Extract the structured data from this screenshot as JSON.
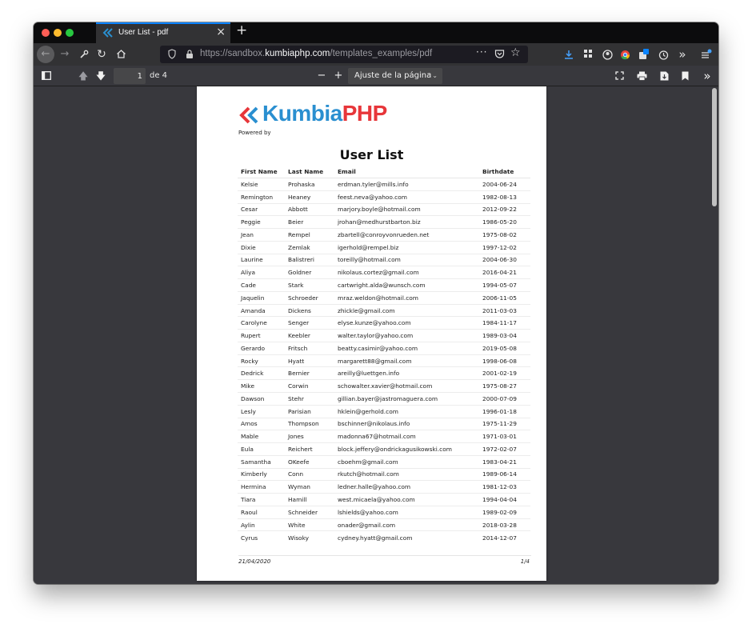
{
  "tab": {
    "title": "User List - pdf",
    "close": "×",
    "new_tab": "+"
  },
  "url": {
    "prefix": "https://sandbox.",
    "host": "kumbiaphp.com",
    "path": "/templates_examples/pdf",
    "more": "···"
  },
  "pdf_toolbar": {
    "page_number": "1",
    "page_of": "de 4",
    "zoom_out": "−",
    "zoom_in": "+",
    "zoom_label": "Ajuste de la página",
    "zoom_caret": "⌃⌄"
  },
  "document": {
    "logo_kumbia": "Kumbia",
    "logo_php": "PHP",
    "powered_by": "Powered by",
    "title": "User List",
    "columns": [
      "First Name",
      "Last Name",
      "Email",
      "Birthdate"
    ],
    "rows": [
      [
        "Kelsie",
        "Prohaska",
        "erdman.tyler@mills.info",
        "2004-06-24"
      ],
      [
        "Remington",
        "Heaney",
        "feest.neva@yahoo.com",
        "1982-08-13"
      ],
      [
        "Cesar",
        "Abbott",
        "marjory.boyle@hotmail.com",
        "2012-09-22"
      ],
      [
        "Peggie",
        "Beier",
        "jrohan@medhurstbarton.biz",
        "1986-05-20"
      ],
      [
        "Jean",
        "Rempel",
        "zbartell@conroyvonrueden.net",
        "1975-08-02"
      ],
      [
        "Dixie",
        "Zemlak",
        "igerhold@rempel.biz",
        "1997-12-02"
      ],
      [
        "Laurine",
        "Balistreri",
        "toreilly@hotmail.com",
        "2004-06-30"
      ],
      [
        "Aliya",
        "Goldner",
        "nikolaus.cortez@gmail.com",
        "2016-04-21"
      ],
      [
        "Cade",
        "Stark",
        "cartwright.alda@wunsch.com",
        "1994-05-07"
      ],
      [
        "Jaquelin",
        "Schroeder",
        "mraz.weldon@hotmail.com",
        "2006-11-05"
      ],
      [
        "Amanda",
        "Dickens",
        "zhickle@gmail.com",
        "2011-03-03"
      ],
      [
        "Carolyne",
        "Senger",
        "elyse.kunze@yahoo.com",
        "1984-11-17"
      ],
      [
        "Rupert",
        "Keebler",
        "walter.taylor@yahoo.com",
        "1989-03-04"
      ],
      [
        "Gerardo",
        "Fritsch",
        "beatty.casimir@yahoo.com",
        "2019-05-08"
      ],
      [
        "Rocky",
        "Hyatt",
        "margarett88@gmail.com",
        "1998-06-08"
      ],
      [
        "Dedrick",
        "Bernier",
        "areilly@luettgen.info",
        "2001-02-19"
      ],
      [
        "Mike",
        "Corwin",
        "schowalter.xavier@hotmail.com",
        "1975-08-27"
      ],
      [
        "Dawson",
        "Stehr",
        "gillian.bayer@jastromaguera.com",
        "2000-07-09"
      ],
      [
        "Lesly",
        "Parisian",
        "hklein@gerhold.com",
        "1996-01-18"
      ],
      [
        "Amos",
        "Thompson",
        "bschinner@nikolaus.info",
        "1975-11-29"
      ],
      [
        "Mable",
        "Jones",
        "madonna67@hotmail.com",
        "1971-03-01"
      ],
      [
        "Eula",
        "Reichert",
        "block.jeffery@ondrickagusikowski.com",
        "1972-02-07"
      ],
      [
        "Samantha",
        "OKeefe",
        "cboehm@gmail.com",
        "1983-04-21"
      ],
      [
        "Kimberly",
        "Conn",
        "rkutch@hotmail.com",
        "1989-06-14"
      ],
      [
        "Hermina",
        "Wyman",
        "ledner.halle@yahoo.com",
        "1981-12-03"
      ],
      [
        "Tiara",
        "Hamill",
        "west.micaela@yahoo.com",
        "1994-04-04"
      ],
      [
        "Raoul",
        "Schneider",
        "lshields@yahoo.com",
        "1989-02-09"
      ],
      [
        "Aylin",
        "White",
        "onader@gmail.com",
        "2018-03-28"
      ],
      [
        "Cyrus",
        "Wisoky",
        "cydney.hyatt@gmail.com",
        "2014-12-07"
      ]
    ],
    "footer_date": "21/04/2020",
    "footer_page": "1/4"
  },
  "colors": {
    "kumbia_blue": "#2a8fd0",
    "php_red": "#e7363a",
    "accent": "#0a84ff"
  },
  "icons": [
    "back-icon",
    "forward-icon",
    "wrench-icon",
    "reload-icon",
    "home-icon",
    "shield-icon",
    "lock-icon",
    "pocket-icon",
    "star-icon",
    "download-icon",
    "extensions-icon",
    "account-icon",
    "chrome-icon",
    "notification-icon",
    "timer-icon",
    "overflow-icon",
    "menu-icon",
    "sidebar-toggle-icon",
    "prev-page-icon",
    "next-page-icon",
    "presentation-icon",
    "print-icon",
    "save-icon",
    "bookmark-icon",
    "tools-icon"
  ]
}
